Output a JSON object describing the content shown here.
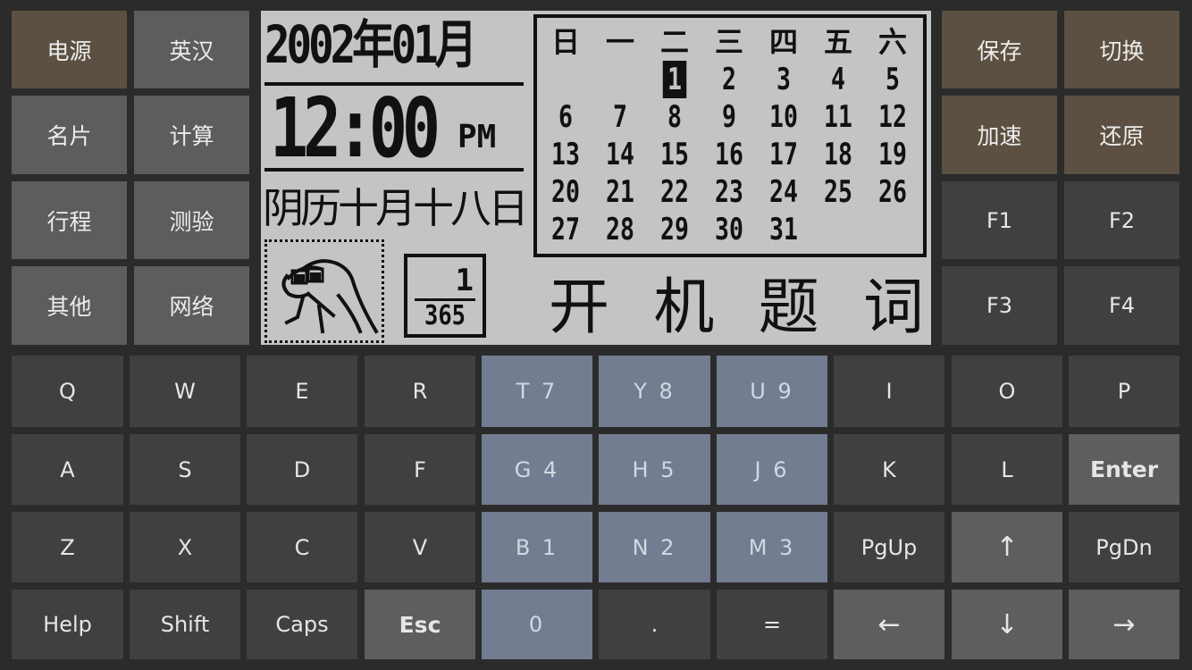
{
  "left_keys": [
    "电源",
    "英汉",
    "名片",
    "计算",
    "行程",
    "测验",
    "其他",
    "网络"
  ],
  "right_keys": [
    "保存",
    "切换",
    "加速",
    "还原",
    "F1",
    "F2",
    "F3",
    "F4"
  ],
  "lcd": {
    "date": "2002年01月",
    "time": "12:00",
    "ampm": "PM",
    "lunar": "阴历十月十八日",
    "calendar": {
      "weekdays": [
        "日",
        "一",
        "二",
        "三",
        "四",
        "五",
        "六"
      ],
      "days": [
        "1",
        "2",
        "3",
        "4",
        "5",
        "6",
        "7",
        "8",
        "9",
        "10",
        "11",
        "12",
        "13",
        "14",
        "15",
        "16",
        "17",
        "18",
        "19",
        "20",
        "21",
        "22",
        "23",
        "24",
        "25",
        "26",
        "27",
        "28",
        "29",
        "30",
        "31"
      ],
      "first_weekday_index": 2,
      "selected_day": "1"
    },
    "counter": {
      "numerator": "1",
      "denominator": "365"
    },
    "slogan": [
      "开",
      "机",
      "题",
      "词"
    ],
    "mascot_icon": "dinosaur-icon"
  },
  "keyboard": {
    "row1": [
      "Q",
      "W",
      "E",
      "R",
      "T 7",
      "Y 8",
      "U 9",
      "I",
      "O",
      "P"
    ],
    "row2": [
      "A",
      "S",
      "D",
      "F",
      "G 4",
      "H 5",
      "J 6",
      "K",
      "L",
      "Enter"
    ],
    "row3": [
      "Z",
      "X",
      "C",
      "V",
      "B 1",
      "N 2",
      "M 3",
      "PgUp",
      "↑",
      "PgDn"
    ],
    "row4": [
      "Help",
      "Shift",
      "Caps",
      "Esc",
      "0",
      ".",
      "=",
      "←",
      "↓",
      "→"
    ]
  },
  "colors": {
    "background": "#2b2b2b",
    "function_key_brown": "#5b5041",
    "function_key_gray": "#5d5d5d",
    "key_dark": "#404040",
    "key_light": "#5e5e5e",
    "numpad_blue": "#727d91",
    "lcd_background": "#c4c4c4",
    "lcd_ink": "#111111"
  }
}
